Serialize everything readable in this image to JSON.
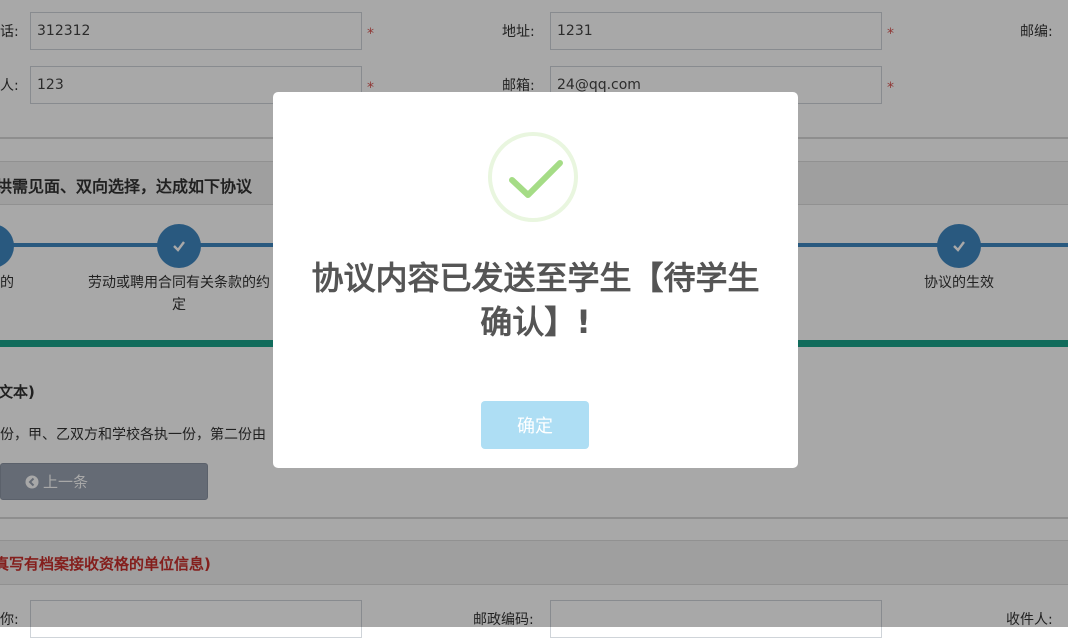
{
  "form": {
    "phone_label": "话:",
    "phone_value": "312312",
    "address_label": "地址:",
    "address_value": "1231",
    "postcode_label": "邮编:",
    "contact_label": "人:",
    "contact_value": "123",
    "email_label": "邮箱:",
    "email_value": "24@qq.com",
    "required_mark": "*"
  },
  "agreement": {
    "heading": "拱需见面、双向选择，达成如下协议"
  },
  "steps": {
    "first_label": "的",
    "second_label": "劳动或聘用合同有关条款的约定",
    "last_label": "协议的生效"
  },
  "text_section": {
    "title": "文本)",
    "paragraph": "份，甲、乙双方和学校各执一份，第二份由",
    "prev_button": "上一条"
  },
  "archive_section": {
    "heading": "真写有档案接收资格的单位信息)",
    "name_label": "你:",
    "postal_code_label": "邮政编码:",
    "recipient_label": "收件人:"
  },
  "modal": {
    "message_line1": "协议内容已发送至学生【待学生",
    "message_line2": "确认】!",
    "confirm_label": "确定"
  },
  "colors": {
    "step_blue": "#3f87c1",
    "teal": "#1aa38b",
    "check_green": "#a5dc86",
    "confirm_button": "#aedef4"
  }
}
